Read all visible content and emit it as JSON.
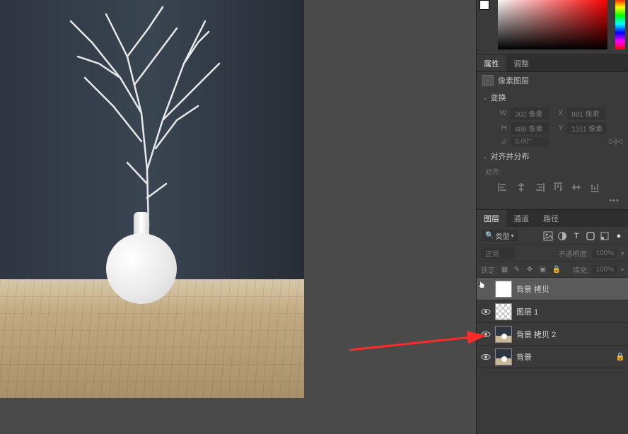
{
  "tabs": {
    "properties": "属性",
    "adjustments": "调整"
  },
  "props": {
    "pixel_layer": "像素图层",
    "transform": "变换",
    "w_label": "W",
    "w_value": "302 像素",
    "x_label": "X",
    "x_value": "881 像素",
    "h_label": "H",
    "h_value": "488 像素",
    "y_label": "Y",
    "y_value": "1311 像素",
    "angle_value": "0.00°",
    "align_distribute": "对齐并分布",
    "align_label": "对齐:"
  },
  "layers_tabs": {
    "layers": "图层",
    "channels": "通道",
    "paths": "路径"
  },
  "filter": {
    "kind": "类型"
  },
  "blend": {
    "mode": "正常",
    "opacity_label": "不透明度:",
    "opacity_value": "100%"
  },
  "lock": {
    "label": "锁定:",
    "fill_label": "填充:",
    "fill_value": "100%"
  },
  "layers": [
    {
      "name": "背景 拷贝",
      "thumb": "mask",
      "selected": true,
      "visible": true
    },
    {
      "name": "图层 1",
      "thumb": "trans",
      "selected": false,
      "visible": true
    },
    {
      "name": "背景 拷贝 2",
      "thumb": "vase",
      "selected": false,
      "visible": true
    },
    {
      "name": "背景",
      "thumb": "vase",
      "selected": false,
      "visible": true,
      "locked": true
    }
  ]
}
